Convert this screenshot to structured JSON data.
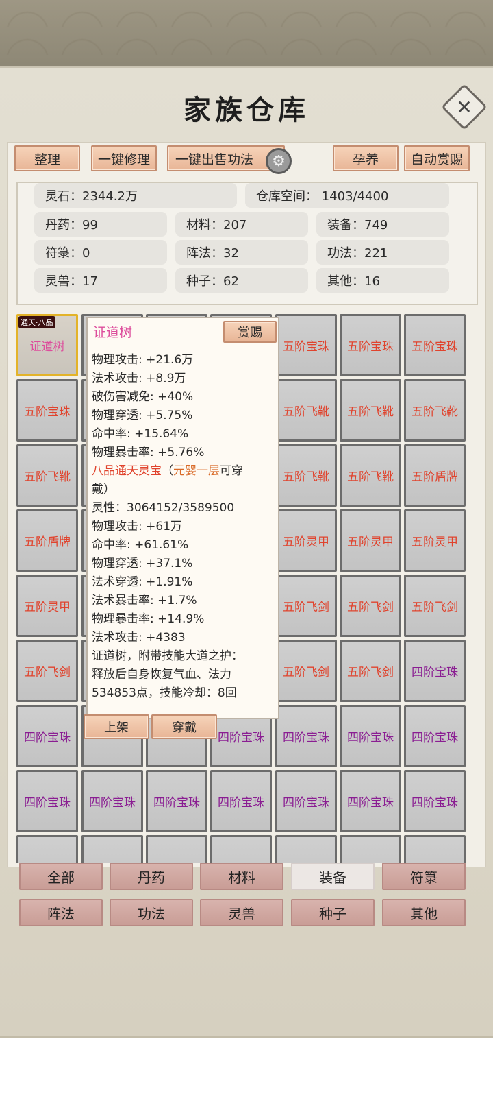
{
  "title": "家族仓库",
  "toolbar": {
    "sort": "整理",
    "repair_all": "一键修理",
    "sell_skills": "一键出售功法",
    "nurture": "孕养",
    "auto_reward": "自动赏赐"
  },
  "stats": {
    "spirit_stone": "灵石：2344.2万",
    "storage": "仓库空间：  1403/4400",
    "pills": "丹药：99",
    "materials": "材料：207",
    "equipment": "装备：749",
    "talismans": "符箓：0",
    "formations": "阵法：32",
    "skills": "功法：221",
    "beasts": "灵兽：17",
    "seeds": "种子：62",
    "others": "其他：16"
  },
  "grid": [
    {
      "label": "证道树",
      "color": "pink",
      "badge": "通天·八品"
    },
    {
      "label": "",
      "color": "red"
    },
    {
      "label": "",
      "color": "red"
    },
    {
      "label": "",
      "color": "red"
    },
    {
      "label": "五阶宝珠",
      "color": "red"
    },
    {
      "label": "五阶宝珠",
      "color": "red"
    },
    {
      "label": "五阶宝珠",
      "color": "red"
    },
    {
      "label": "五阶宝珠",
      "color": "red"
    },
    {
      "label": "",
      "color": "red"
    },
    {
      "label": "",
      "color": "red"
    },
    {
      "label": "",
      "color": "red"
    },
    {
      "label": "五阶飞靴",
      "color": "red"
    },
    {
      "label": "五阶飞靴",
      "color": "red"
    },
    {
      "label": "五阶飞靴",
      "color": "red"
    },
    {
      "label": "五阶飞靴",
      "color": "red"
    },
    {
      "label": "",
      "color": "red"
    },
    {
      "label": "",
      "color": "red"
    },
    {
      "label": "",
      "color": "red"
    },
    {
      "label": "五阶飞靴",
      "color": "red"
    },
    {
      "label": "五阶飞靴",
      "color": "red"
    },
    {
      "label": "五阶盾牌",
      "color": "red"
    },
    {
      "label": "五阶盾牌",
      "color": "red"
    },
    {
      "label": "",
      "color": "red"
    },
    {
      "label": "",
      "color": "red"
    },
    {
      "label": "",
      "color": "red"
    },
    {
      "label": "五阶灵甲",
      "color": "red"
    },
    {
      "label": "五阶灵甲",
      "color": "red"
    },
    {
      "label": "五阶灵甲",
      "color": "red"
    },
    {
      "label": "五阶灵甲",
      "color": "red"
    },
    {
      "label": "",
      "color": "red"
    },
    {
      "label": "",
      "color": "red"
    },
    {
      "label": "",
      "color": "red"
    },
    {
      "label": "五阶飞剑",
      "color": "red"
    },
    {
      "label": "五阶飞剑",
      "color": "red"
    },
    {
      "label": "五阶飞剑",
      "color": "red"
    },
    {
      "label": "五阶飞剑",
      "color": "red"
    },
    {
      "label": "",
      "color": "red"
    },
    {
      "label": "",
      "color": "red"
    },
    {
      "label": "",
      "color": "red"
    },
    {
      "label": "五阶飞剑",
      "color": "red"
    },
    {
      "label": "五阶飞剑",
      "color": "red"
    },
    {
      "label": "四阶宝珠",
      "color": "purple"
    },
    {
      "label": "四阶宝珠",
      "color": "purple"
    },
    {
      "label": "",
      "color": "purple"
    },
    {
      "label": "",
      "color": "purple"
    },
    {
      "label": "四阶宝珠",
      "color": "purple"
    },
    {
      "label": "四阶宝珠",
      "color": "purple"
    },
    {
      "label": "四阶宝珠",
      "color": "purple"
    },
    {
      "label": "四阶宝珠",
      "color": "purple"
    },
    {
      "label": "四阶宝珠",
      "color": "purple"
    },
    {
      "label": "四阶宝珠",
      "color": "purple"
    },
    {
      "label": "四阶宝珠",
      "color": "purple"
    },
    {
      "label": "四阶宝珠",
      "color": "purple"
    },
    {
      "label": "四阶宝珠",
      "color": "purple"
    },
    {
      "label": "四阶宝珠",
      "color": "purple"
    },
    {
      "label": "四阶宝珠",
      "color": "purple"
    },
    {
      "label": "",
      "color": "purple"
    },
    {
      "label": "",
      "color": "purple"
    },
    {
      "label": "",
      "color": "purple"
    },
    {
      "label": "",
      "color": "purple"
    },
    {
      "label": "",
      "color": "purple"
    },
    {
      "label": "",
      "color": "purple"
    },
    {
      "label": "",
      "color": "purple"
    }
  ],
  "tooltip": {
    "name": "证道树",
    "reward_btn": "赏赐",
    "line1": "物理攻击: +21.6万",
    "line2": "法术攻击: +8.9万",
    "line3": "破伤害减免: +40%",
    "line4": "物理穿透: +5.75%",
    "line5": "命中率: +15.64%",
    "line6": "物理暴击率: +5.76%",
    "line7a": "八品通天灵宝",
    "line7b": "（",
    "line7c": "元婴一层",
    "line7d": "可穿",
    "line8": "戴）",
    "line9": "灵性：3064152/3589500",
    "line10": "物理攻击: +61万",
    "line11": "命中率: +61.61%",
    "line12": "物理穿透: +37.1%",
    "line13": "法术穿透: +1.91%",
    "line14": "法术暴击率: +1.7%",
    "line15": "物理暴击率: +14.9%",
    "line16": "法术攻击: +4383",
    "line17": "证道树，附带技能大道之护：",
    "line18": "释放后自身恢复气血、法力",
    "line19": "534853点，技能冷却：8回",
    "list_btn": "上架",
    "equip_btn": "穿戴"
  },
  "tabs": [
    "全部",
    "丹药",
    "材料",
    "装备",
    "符箓",
    "阵法",
    "功法",
    "灵兽",
    "种子",
    "其他"
  ],
  "active_tab": "装备"
}
